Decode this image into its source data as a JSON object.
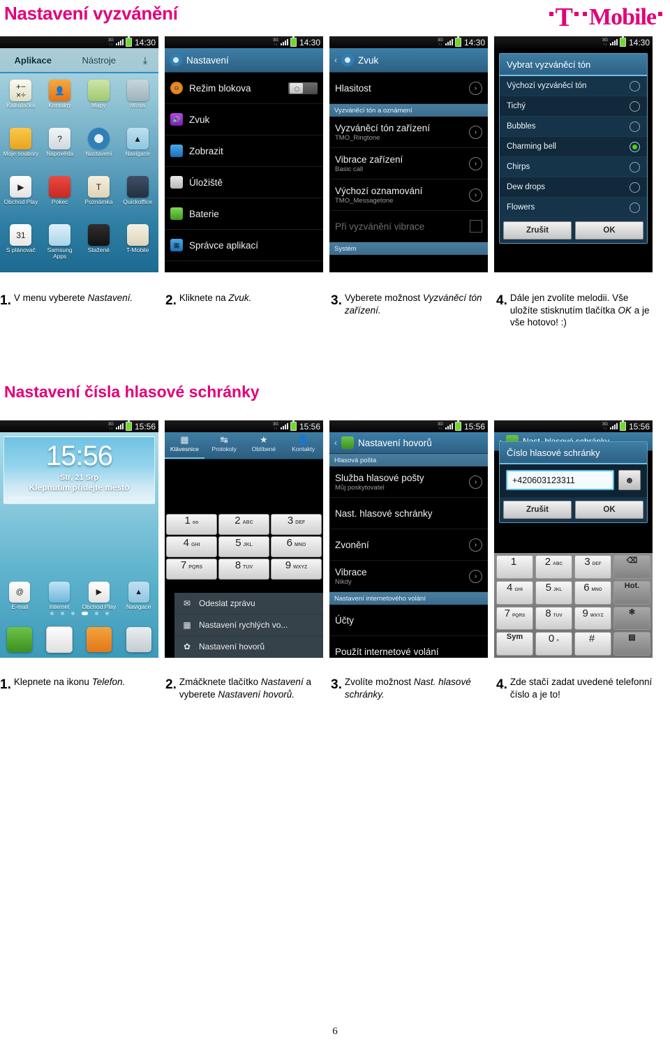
{
  "header": {
    "title": "Nastavení vyzvánění",
    "logo": {
      "t": "T",
      "word": "Mobile"
    }
  },
  "section2": {
    "title": "Nastavení čísla hlasové schránky"
  },
  "footer": {
    "page_number": "6"
  },
  "row1": {
    "shots": [
      {
        "name": "app-drawer",
        "status": {
          "net": "3G",
          "time": "14:30"
        },
        "tabs": {
          "apps": "Aplikace",
          "tools": "Nástroje",
          "download_icon": "download-icon"
        },
        "apps": [
          {
            "label": "Kalkulačka",
            "icon": "calculator-icon"
          },
          {
            "label": "Kontakty",
            "icon": "contacts-icon"
          },
          {
            "label": "Mapy",
            "icon": "maps-icon"
          },
          {
            "label": "Místa",
            "icon": "places-pin-icon"
          },
          {
            "label": "Moje soubory",
            "icon": "folder-icon"
          },
          {
            "label": "Nápověda",
            "icon": "help-book-icon"
          },
          {
            "label": "Nastavení",
            "icon": "gear-icon"
          },
          {
            "label": "Navigace",
            "icon": "navigation-arrow-icon"
          },
          {
            "label": "Obchod Play",
            "icon": "play-store-icon"
          },
          {
            "label": "Pokec",
            "icon": "chat-bubble-icon"
          },
          {
            "label": "Poznámka",
            "icon": "memo-icon"
          },
          {
            "label": "Quickoffice",
            "icon": "quickoffice-icon"
          },
          {
            "label": "S plánovač",
            "icon": "calendar-31-icon"
          },
          {
            "label": "Samsung Apps",
            "icon": "samsung-apps-icon"
          },
          {
            "label": "Stažené",
            "icon": "downloads-icon"
          },
          {
            "label": "T-Mobile",
            "icon": "tmobile-sim-icon"
          }
        ]
      },
      {
        "name": "settings-list",
        "status": {
          "net": "3G",
          "time": "14:30"
        },
        "actionbar": {
          "title": "Nastavení",
          "icon": "gear-icon"
        },
        "rows": [
          {
            "label": "Režim blokova",
            "icon": "block-mode-icon",
            "control": "toggle"
          },
          {
            "label": "Zvuk",
            "icon": "sound-icon",
            "control": "none"
          },
          {
            "label": "Zobrazit",
            "icon": "display-icon",
            "control": "none"
          },
          {
            "label": "Úložiště",
            "icon": "storage-icon",
            "control": "none"
          },
          {
            "label": "Baterie",
            "icon": "battery-icon",
            "control": "none"
          },
          {
            "label": "Správce aplikací",
            "icon": "app-manager-icon",
            "control": "none"
          }
        ]
      },
      {
        "name": "sound-settings",
        "status": {
          "net": "3G",
          "time": "14:30"
        },
        "actionbar": {
          "title": "Zvuk",
          "icon": "gear-icon",
          "back": "back-arrow-icon"
        },
        "rows": [
          {
            "type": "item",
            "title": "Hlasitost",
            "sub": "",
            "chev": true
          },
          {
            "type": "section",
            "title": "Vyzváněcí tón a oznámení"
          },
          {
            "type": "item",
            "title": "Vyzváněcí tón zařízení",
            "sub": "TMO_Ringtone",
            "chev": true
          },
          {
            "type": "item",
            "title": "Vibrace zařízení",
            "sub": "Basic call",
            "chev": true
          },
          {
            "type": "item",
            "title": "Výchozí oznamování",
            "sub": "TMO_Messagetone",
            "chev": true
          },
          {
            "type": "check",
            "title": "Při vyzvánění vibrace",
            "dim": true
          },
          {
            "type": "section",
            "title": "Systém"
          }
        ]
      },
      {
        "name": "ringtone-picker-dialog",
        "status": {
          "net": "3G",
          "time": "14:30"
        },
        "dialog": {
          "title": "Vybrat vyzváněcí tón",
          "options": [
            {
              "label": "Výchozí vyzváněcí tón",
              "selected": false
            },
            {
              "label": "Tichý",
              "selected": false
            },
            {
              "label": "Bubbles",
              "selected": false
            },
            {
              "label": "Charming bell",
              "selected": true
            },
            {
              "label": "Chirps",
              "selected": false
            },
            {
              "label": "Dew drops",
              "selected": false
            },
            {
              "label": "Flowers",
              "selected": false
            }
          ],
          "cancel": "Zrušit",
          "ok": "OK"
        }
      }
    ],
    "captions": [
      {
        "n": "1.",
        "parts": [
          {
            "t": "V menu vyberete ",
            "i": false
          },
          {
            "t": "Nastavení.",
            "i": true
          }
        ]
      },
      {
        "n": "2.",
        "parts": [
          {
            "t": "Kliknete na ",
            "i": false
          },
          {
            "t": "Zvuk.",
            "i": true
          }
        ]
      },
      {
        "n": "3.",
        "parts": [
          {
            "t": "Vyberete možnost ",
            "i": false
          },
          {
            "t": "Vyzváněcí tón zařízení.",
            "i": true
          }
        ]
      },
      {
        "n": "4.",
        "parts": [
          {
            "t": "Dále jen zvolíte melodii. Vše uložíte stisknutím tlačítka ",
            "i": false
          },
          {
            "t": "OK",
            "i": true
          },
          {
            "t": " a je vše hotovo! :)",
            "i": false
          }
        ]
      }
    ]
  },
  "row2": {
    "shots": [
      {
        "name": "home-screen",
        "status": {
          "net": "3G",
          "time": "15:56"
        },
        "widget": {
          "time": "15:56",
          "date": "Stř, 21 Srp",
          "tap": "Klepnutím přidejte město",
          "watermark": "AccuWeather.com"
        },
        "apps": [
          {
            "label": "E-mail",
            "icon": "email-icon"
          },
          {
            "label": "Internet",
            "icon": "internet-icon"
          },
          {
            "label": "Obchod Play",
            "icon": "play-store-icon"
          },
          {
            "label": "Navigace",
            "icon": "navigation-arrow-icon"
          }
        ],
        "dock": [
          "phone-icon",
          "messages-icon",
          "contacts-icon",
          "app-drawer-icon"
        ]
      },
      {
        "name": "dialer-with-menu",
        "status": {
          "net": "3G",
          "time": "15:56"
        },
        "tabs": [
          {
            "label": "Klávesnice",
            "icon": "keypad-icon",
            "active": true
          },
          {
            "label": "Protokoly",
            "icon": "call-log-icon",
            "active": false
          },
          {
            "label": "Oblíbené",
            "icon": "star-icon",
            "active": false
          },
          {
            "label": "Kontakty",
            "icon": "contacts-icon",
            "active": false
          }
        ],
        "keys": [
          {
            "num": "1",
            "sub": "oo"
          },
          {
            "num": "2",
            "sub": "ABC"
          },
          {
            "num": "3",
            "sub": "DEF"
          },
          {
            "num": "4",
            "sub": "GHI"
          },
          {
            "num": "5",
            "sub": "JKL"
          },
          {
            "num": "6",
            "sub": "MNO"
          },
          {
            "num": "7",
            "sub": "PQRS"
          },
          {
            "num": "8",
            "sub": "TUV"
          },
          {
            "num": "9",
            "sub": "WXYZ"
          }
        ],
        "menu": [
          {
            "label": "Odeslat zprávu",
            "icon": "envelope-icon"
          },
          {
            "label": "Nastavení rychlých vo...",
            "icon": "speed-dial-icon"
          },
          {
            "label": "Nastavení hovorů",
            "icon": "gear-icon"
          }
        ]
      },
      {
        "name": "call-settings",
        "status": {
          "net": "3G",
          "time": "15:56"
        },
        "actionbar": {
          "title": "Nastavení hovorů",
          "icon": "phone-icon",
          "back": "back-arrow-icon"
        },
        "rows": [
          {
            "type": "section",
            "title": "Hlasová pošta"
          },
          {
            "type": "item",
            "title": "Služba hlasové pošty",
            "sub": "Můj poskytovatel",
            "chev": true
          },
          {
            "type": "item",
            "title": "Nast. hlasové schránky",
            "sub": "",
            "chev": false
          },
          {
            "type": "item",
            "title": "Zvonění",
            "sub": "",
            "chev": true
          },
          {
            "type": "item",
            "title": "Vibrace",
            "sub": "Nikdy",
            "chev": true
          },
          {
            "type": "section",
            "title": "Nastavení internetového volání"
          },
          {
            "type": "item",
            "title": "Účty",
            "sub": "",
            "chev": false
          },
          {
            "type": "item",
            "title": "Použít internetové volání",
            "sub": "",
            "chev": false
          }
        ]
      },
      {
        "name": "voicemail-number-dialog",
        "status": {
          "net": "3G",
          "time": "15:56"
        },
        "behind_title": "Nast. hlasové schránky",
        "dialog": {
          "title": "Číslo hlasové schránky",
          "value": "+420603123311",
          "picker_icon": "contact-picker-icon",
          "cancel": "Zrušit",
          "ok": "OK"
        },
        "keys": [
          {
            "num": "1",
            "sub": ""
          },
          {
            "num": "2",
            "sub": "ABC"
          },
          {
            "num": "3",
            "sub": "DEF"
          },
          {
            "full": "⌫",
            "dark": true
          },
          {
            "num": "4",
            "sub": "GHI"
          },
          {
            "num": "5",
            "sub": "JKL"
          },
          {
            "num": "6",
            "sub": "MNO"
          },
          {
            "full": "Hot.",
            "dark": true
          },
          {
            "num": "7",
            "sub": "PQRS"
          },
          {
            "num": "8",
            "sub": "TUV"
          },
          {
            "num": "9",
            "sub": "WXYZ"
          },
          {
            "full": "✻",
            "dark": true
          },
          {
            "full": "Sym",
            "dark": false
          },
          {
            "num": "0",
            "sub": "+"
          },
          {
            "num": "#",
            "sub": ""
          },
          {
            "full": "▤",
            "dark": true
          }
        ]
      }
    ],
    "captions": [
      {
        "n": "1.",
        "parts": [
          {
            "t": "Klepnete na ikonu ",
            "i": false
          },
          {
            "t": "Telefon.",
            "i": true
          }
        ]
      },
      {
        "n": "2.",
        "parts": [
          {
            "t": "Zmáčknete tlačítko ",
            "i": false
          },
          {
            "t": "Nastavení",
            "i": true
          },
          {
            "t": " a vyberete ",
            "i": false
          },
          {
            "t": "Nastavení hovorů.",
            "i": true
          }
        ]
      },
      {
        "n": "3.",
        "parts": [
          {
            "t": "Zvolíte možnost ",
            "i": false
          },
          {
            "t": "Nast. hlasové schránky.",
            "i": true
          }
        ]
      },
      {
        "n": "4.",
        "parts": [
          {
            "t": "Zde stačí zadat uvedené telefonní číslo a je to!",
            "i": false
          }
        ]
      }
    ]
  },
  "colors": {
    "brand_magenta": "#e2007a",
    "android_blue": "#3d7ea8",
    "radio_green": "#4ed310"
  }
}
